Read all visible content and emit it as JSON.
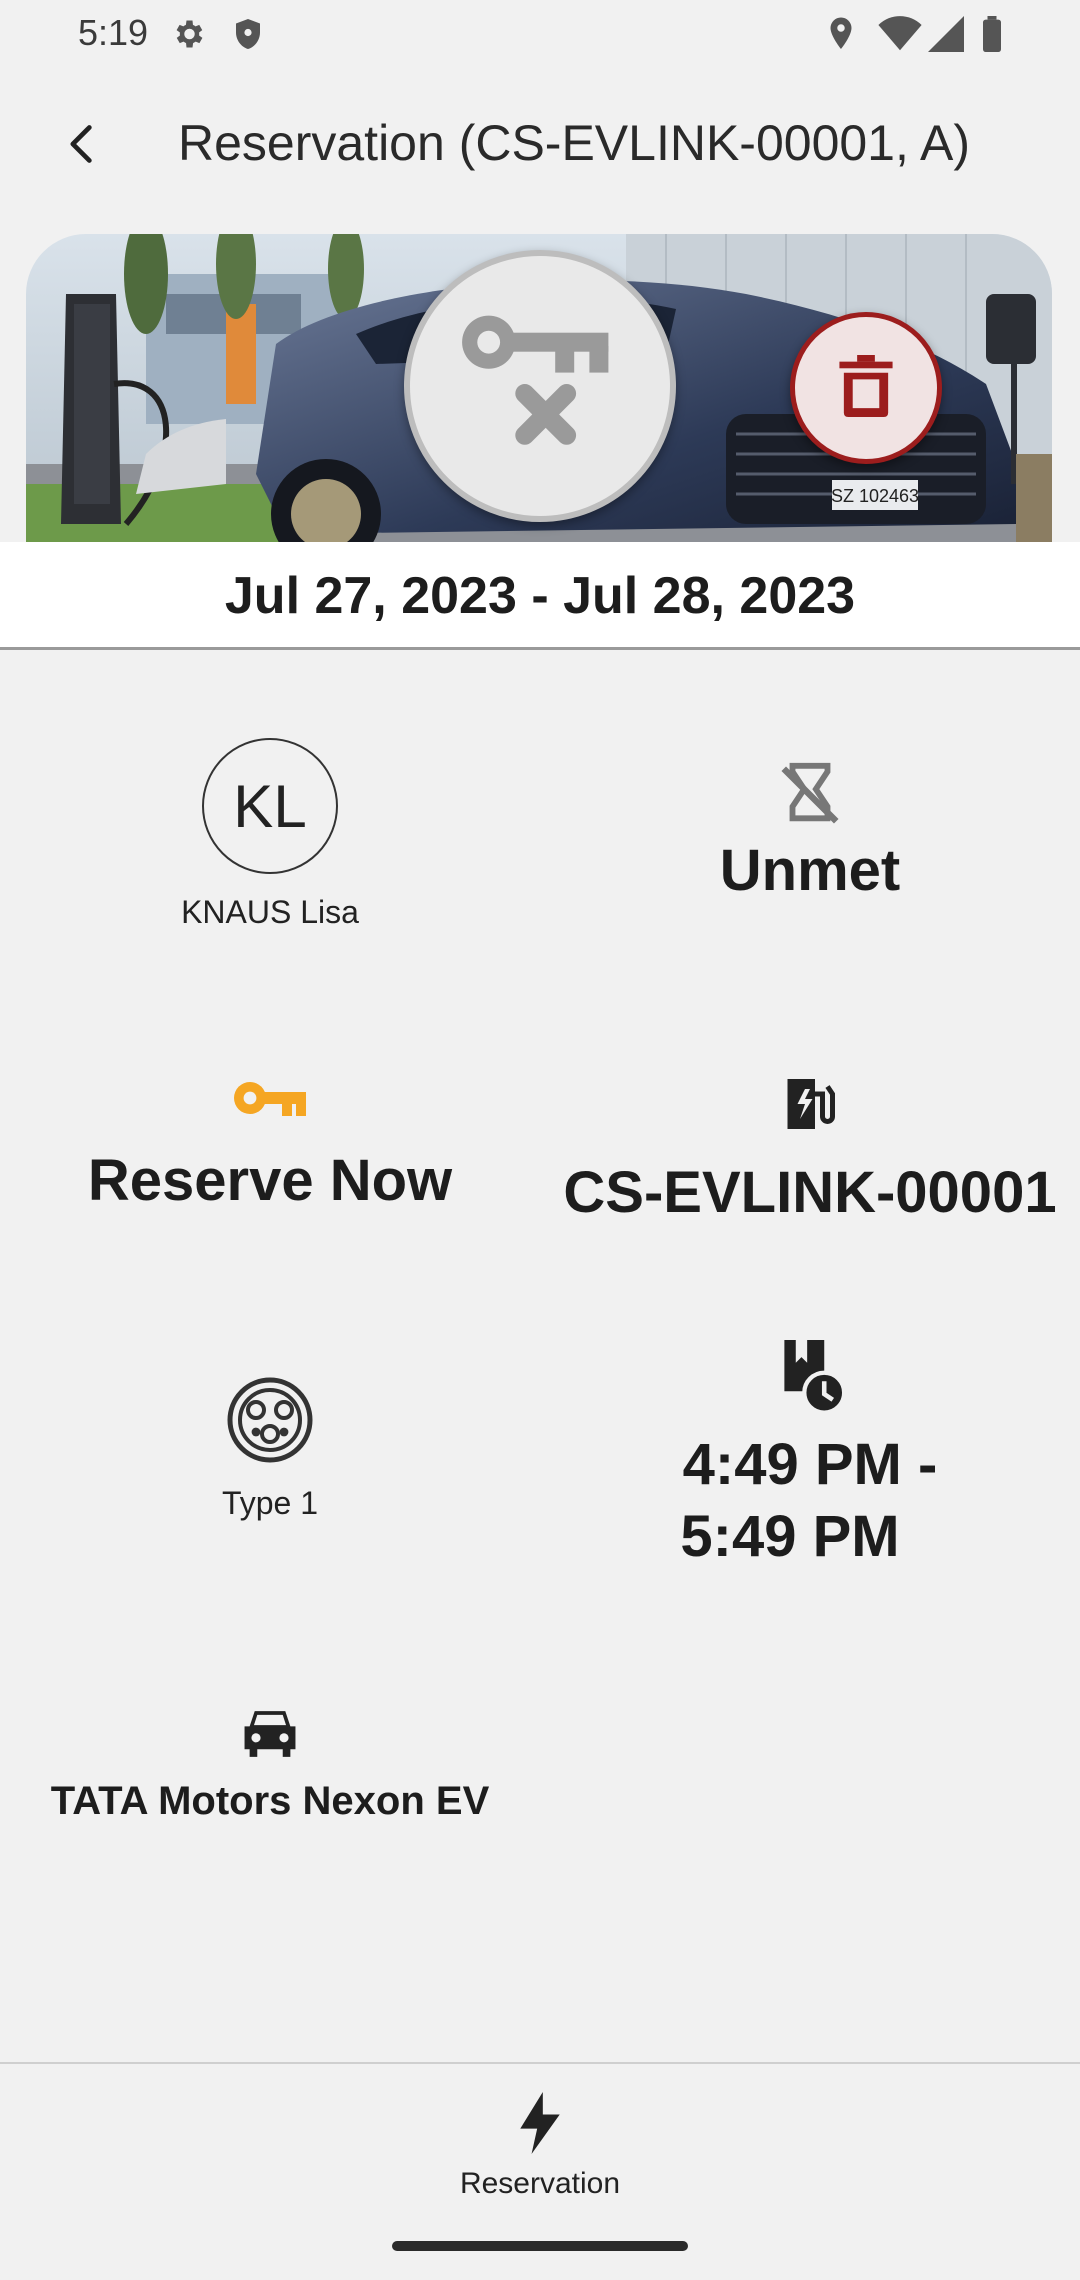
{
  "status_bar": {
    "time": "5:19",
    "icons_left": [
      "settings-gear-icon",
      "shield-icon"
    ],
    "icons_right": [
      "location-pin-icon",
      "wifi-icon",
      "cell-signal-icon",
      "battery-icon"
    ]
  },
  "app_bar": {
    "back_icon": "arrow-back-icon",
    "title": "Reservation (CS-EVLINK-00001, A)"
  },
  "hero": {
    "image": "ev-charging-car-photo",
    "cancel_reservation_icon": "key-x-icon",
    "delete_icon": "trash-icon",
    "date_range": "Jul 27, 2023 - Jul 28, 2023"
  },
  "details": {
    "user": {
      "initials": "KL",
      "name": "KNAUS Lisa"
    },
    "status": {
      "icon": "hourglass-disabled-icon",
      "label": "Unmet"
    },
    "type": {
      "icon": "key-icon",
      "label": "Reserve Now",
      "icon_color": "#f5a623"
    },
    "charger": {
      "icon": "ev-station-icon",
      "label": "CS-EVLINK-00001"
    },
    "connector": {
      "icon": "type1-connector-icon",
      "label": "Type 1"
    },
    "time": {
      "icon": "calendar-clock-icon",
      "line1": "4:49 PM -",
      "line2": "5:49 PM"
    },
    "car": {
      "icon": "car-icon",
      "label": "TATA Motors Nexon EV"
    }
  },
  "bottom_nav": {
    "items": [
      {
        "icon": "bolt-icon",
        "label": "Reservation"
      }
    ]
  },
  "colors": {
    "background": "#f1f1f1",
    "accent_key": "#f5a623",
    "delete_red": "#9c1d1d"
  }
}
